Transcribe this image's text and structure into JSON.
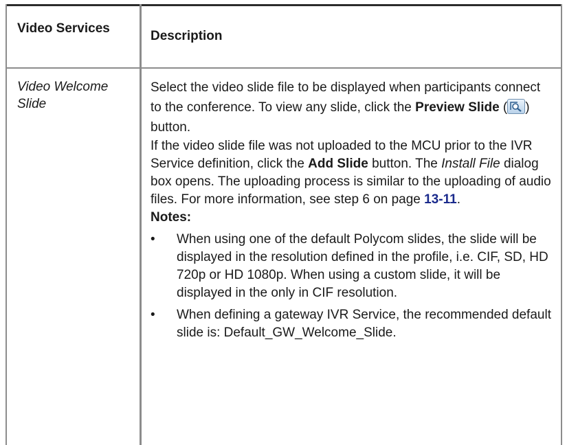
{
  "header": {
    "col1": "Video Services",
    "col2": "Description"
  },
  "row": {
    "term": "Video Welcome Slide",
    "p1_text": "Select the video slide file to be displayed when participants connect to the conference. To view any slide, click the ",
    "p1_bold": "Preview Slide",
    "p1_open": " (",
    "p1_icon": "preview-slide-icon",
    "p1_close": ") button.",
    "p2_a": "If the video slide file was not uploaded to the MCU prior to the IVR Service definition, click the ",
    "p2_bold": "Add Slide",
    "p2_b": " button. The ",
    "p2_italic": "Install File",
    "p2_c": " dialog box opens. The uploading process is similar to the uploading of audio files. For more information, see step 6 on page ",
    "p2_link": "13-11",
    "p2_end": ".",
    "notes_label": "Notes:",
    "bullet": "•",
    "bullets": [
      "When using one of the default Polycom slides, the slide will be displayed in the resolution defined in the profile, i.e. CIF, SD, HD 720p or HD 1080p. When using a custom slide, it will be displayed in the only in CIF resolution.",
      "When defining a gateway IVR Service, the recommended default slide is: Default_GW_Welcome_Slide."
    ]
  },
  "colors": {
    "link": "#1a2a8c",
    "rule": "#8c8c8c",
    "top_rule": "#2b2b2b"
  }
}
